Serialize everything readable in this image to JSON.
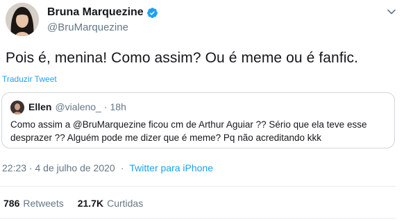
{
  "author": {
    "name": "Bruna Marquezine",
    "handle": "@BruMarquezine",
    "verified_icon": "verified-badge-icon"
  },
  "tweet": {
    "text": "Pois é, menina! Como assim? Ou é meme ou é fanfic.",
    "translate_label": "Traduzir Tweet"
  },
  "quote": {
    "name": "Ellen",
    "handle": "@vialeno_",
    "dot": "·",
    "time": "18h",
    "body": "Como assim a @BruMarquezine ficou cm de Arthur Aguiar ?? Sério que ela teve esse desprazer ?? Alguém pode me dizer que é meme? Pq não acreditando kkk"
  },
  "meta": {
    "timestamp": "22:23 · 4 de julho de 2020",
    "separator": "·",
    "source": "Twitter para iPhone"
  },
  "stats": {
    "retweets_count": "786",
    "retweets_label": "Retweets",
    "likes_count": "21.7K",
    "likes_label": "Curtidas"
  },
  "colors": {
    "accent": "#1da1f2",
    "secondary_text": "#657786",
    "border": "#ccd6dd"
  }
}
